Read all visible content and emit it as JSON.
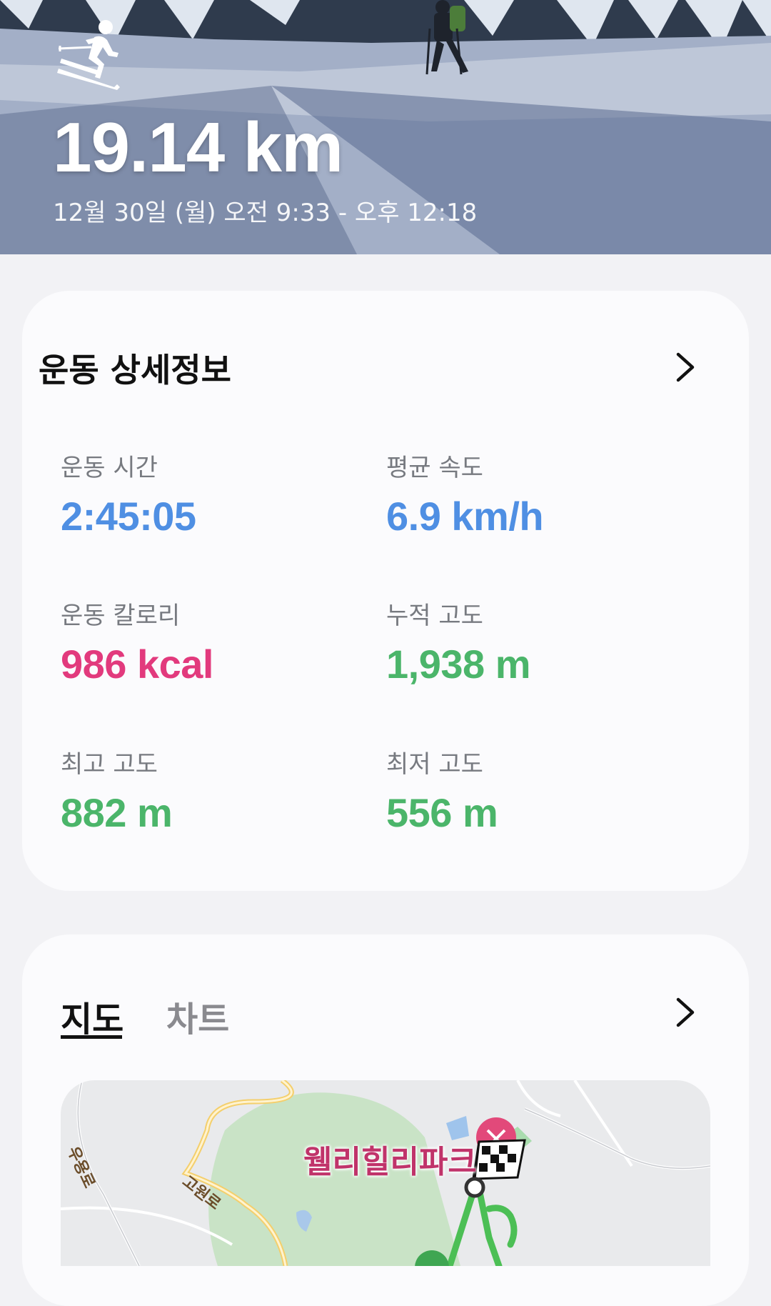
{
  "header": {
    "distance": "19.14 km",
    "date_range": "12월 30일 (월) 오전 9:33 - 오후 12:18",
    "activity_icon": "skier-icon"
  },
  "details": {
    "title": "운동 상세정보",
    "stats": [
      {
        "label": "운동 시간",
        "value": "2:45:05",
        "color": "#4f8fe3"
      },
      {
        "label": "평균 속도",
        "value": "6.9 km/h",
        "color": "#4f8fe3"
      },
      {
        "label": "운동 칼로리",
        "value": "986 kcal",
        "color": "#e23a7d"
      },
      {
        "label": "누적 고도",
        "value": "1,938 m",
        "color": "#4bb56a"
      },
      {
        "label": "최고 고도",
        "value": "882 m",
        "color": "#4bb56a"
      },
      {
        "label": "최저 고도",
        "value": "556 m",
        "color": "#4bb56a"
      }
    ]
  },
  "map_card": {
    "tabs": [
      {
        "label": "지도",
        "active": true
      },
      {
        "label": "차트",
        "active": false
      }
    ],
    "map": {
      "place_label": "웰리힐리파크",
      "road_labels": [
        "우용로",
        "고원로"
      ]
    }
  }
}
